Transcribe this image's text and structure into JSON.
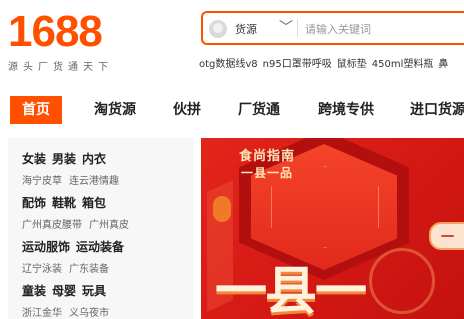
{
  "header": {
    "logo": "1688",
    "slogan": "源头厂货通天下"
  },
  "search": {
    "category": "货源",
    "chevron": "﹀",
    "placeholder": "请输入关键词",
    "hot_keywords": [
      "otg数据线v8",
      "n95口罩带呼吸",
      "鼠标垫",
      "450ml塑料瓶",
      "鼻"
    ]
  },
  "nav": {
    "items": [
      "首页",
      "淘货源",
      "伙拼",
      "厂货通",
      "跨境专供",
      "进口货源"
    ],
    "active_index": 0
  },
  "categories": [
    {
      "main": [
        "女装",
        "男装",
        "内衣"
      ],
      "sub": [
        "海宁皮草",
        "连云港情趣"
      ]
    },
    {
      "main": [
        "配饰",
        "鞋靴",
        "箱包"
      ],
      "sub": [
        "广州真皮腰带",
        "广州真皮"
      ]
    },
    {
      "main": [
        "运动服饰",
        "运动装备"
      ],
      "sub": [
        "辽宁泳装",
        "广东装备"
      ]
    },
    {
      "main": [
        "童装",
        "母婴",
        "玩具"
      ],
      "sub": [
        "浙江金华",
        "义乌夜市"
      ]
    }
  ],
  "banner": {
    "title_line1": "食尚指南",
    "title_line2": "一县一品",
    "pill_text": "一",
    "big_text": "一县一",
    "colors": {
      "background": "#d41814",
      "accent": "#ffe6b8"
    }
  },
  "colors": {
    "brand": "#ff5000"
  }
}
